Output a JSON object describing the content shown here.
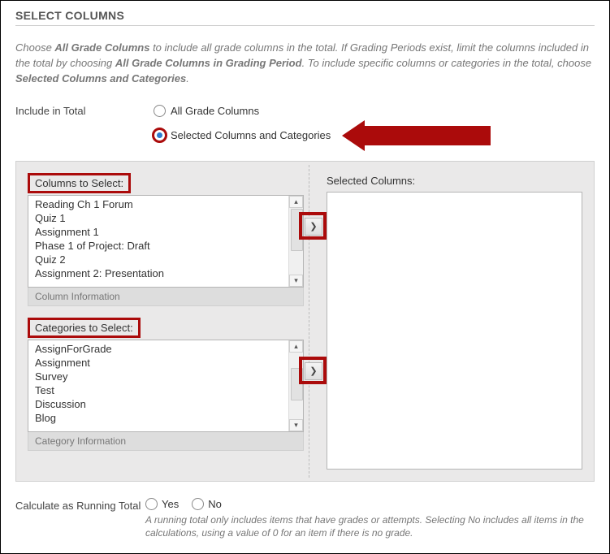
{
  "section_title": "SELECT COLUMNS",
  "intro": {
    "p1a": "Choose ",
    "b1": "All Grade Columns",
    "p1b": " to include all grade columns in the total. If Grading Periods exist, limit the columns included in the total by choosing ",
    "b2": "All Grade Columns in Grading Period",
    "p1c": ". To include specific columns or categories in the total, choose ",
    "b3": "Selected Columns and Categories",
    "p1d": "."
  },
  "include": {
    "label": "Include in Total",
    "opt1": "All Grade Columns",
    "opt2": "Selected Columns and Categories",
    "selected": 2
  },
  "columns": {
    "title": "Columns to Select:",
    "items": [
      "Reading Ch 1 Forum",
      "Quiz 1",
      "Assignment 1",
      "Phase 1 of Project: Draft",
      "Quiz 2",
      "Assignment 2: Presentation"
    ],
    "footer": "Column Information"
  },
  "categories": {
    "title": "Categories to Select:",
    "items": [
      "AssignForGrade",
      "Assignment",
      "Survey",
      "Test",
      "Discussion",
      "Blog"
    ],
    "footer": "Category Information"
  },
  "selected_box": {
    "title": "Selected Columns:"
  },
  "move_icon": "❯",
  "calc": {
    "label": "Calculate as Running Total",
    "yes": "Yes",
    "no": "No",
    "help": "A running total only includes items that have grades or attempts. Selecting No includes all items in the calculations, using a value of 0 for an item if there is no grade."
  }
}
